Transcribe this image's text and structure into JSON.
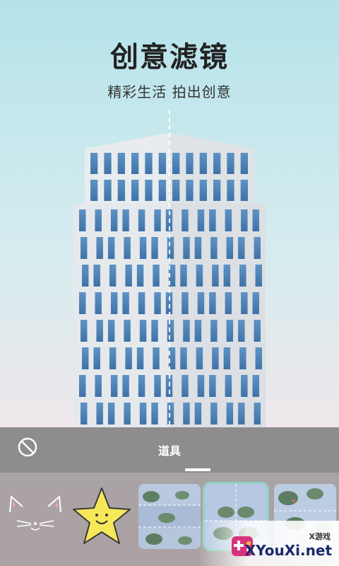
{
  "hero": {
    "title": "创意滤镜",
    "subtitle": "精彩生活 拍出创意"
  },
  "panel": {
    "no_filter_icon": "prohibit-icon",
    "tab_label": "道具"
  },
  "stickers": [
    {
      "name": "cat-whiskers"
    },
    {
      "name": "smiling-star"
    },
    {
      "name": "plant-triptych"
    },
    {
      "name": "plant-mirror"
    },
    {
      "name": "plant-leaves"
    }
  ],
  "watermark": {
    "small": "X游戏",
    "big": "XYouXi.net"
  },
  "colors": {
    "sky_top": "#b5e3ea",
    "sky_bottom": "#f6dfe3",
    "panel": "#6e6e6e",
    "selected": "#8fd3c7"
  }
}
